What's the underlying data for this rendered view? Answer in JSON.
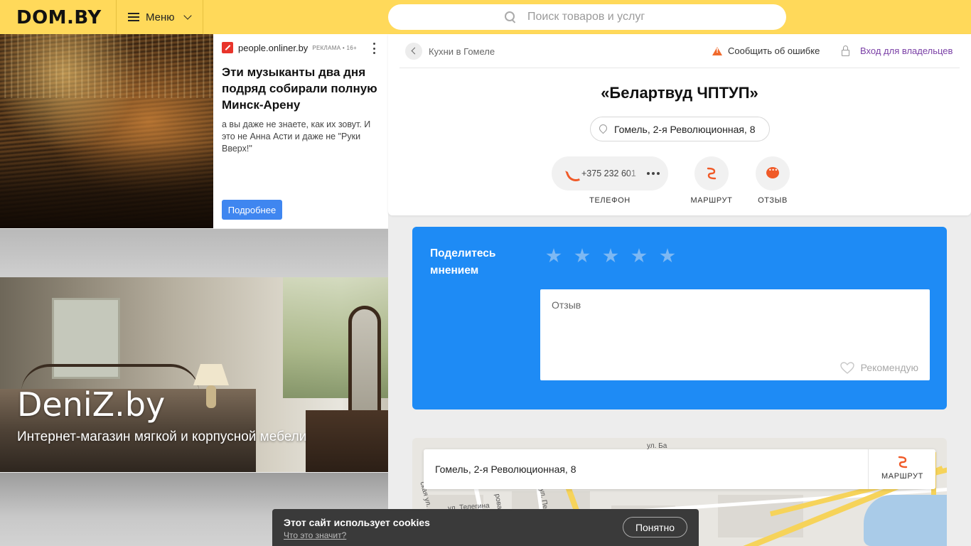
{
  "header": {
    "logo": "DOM.BY",
    "menu_label": "Меню",
    "search_placeholder": "Поиск товаров и услуг",
    "bg_color": "#ffd95a"
  },
  "ads": {
    "ad1": {
      "brand": "people.onliner.by",
      "tag": "РЕКЛАМА • 16+",
      "title": "Эти музыканты два дня подряд собирали полную Минск-Арену",
      "text": "а вы даже не знаете, как их зовут. И это не Анна Асти и даже не \"Руки Вверх!\"",
      "button": "Подробнее"
    },
    "ad2": {
      "title": "DeniZ.by",
      "subtitle": "Интернет-магазин мягкой и корпусной мебели"
    }
  },
  "card": {
    "breadcrumb": "Кухни в Гомеле",
    "report_error": "Сообщить об ошибке",
    "owner_login": "Вход для владельцев",
    "company_name": "«Белартвуд ЧПТУП»",
    "address": "Гомель, 2-я Революционная, 8",
    "phone": "+375 232 601",
    "actions": {
      "phone_label": "ТЕЛЕФОН",
      "route_label": "МАРШРУТ",
      "review_label": "ОТЗЫВ"
    },
    "accent_color": "#f05a28"
  },
  "review": {
    "title": "Поделитесь мнением",
    "stars": 5,
    "placeholder": "Отзыв",
    "recommend": "Рекомендую",
    "bg_color": "#1e8bf5"
  },
  "map": {
    "address": "Гомель, 2-я Революционная, 8",
    "route_label": "МАРШРУТ",
    "street_labels": [
      "ул. Телегина",
      "ул. Пе",
      "рова",
      "ская ул.",
      "ул. Ба"
    ]
  },
  "cookie": {
    "title": "Этот сайт использует cookies",
    "link": "Что это значит?",
    "button": "Понятно"
  }
}
